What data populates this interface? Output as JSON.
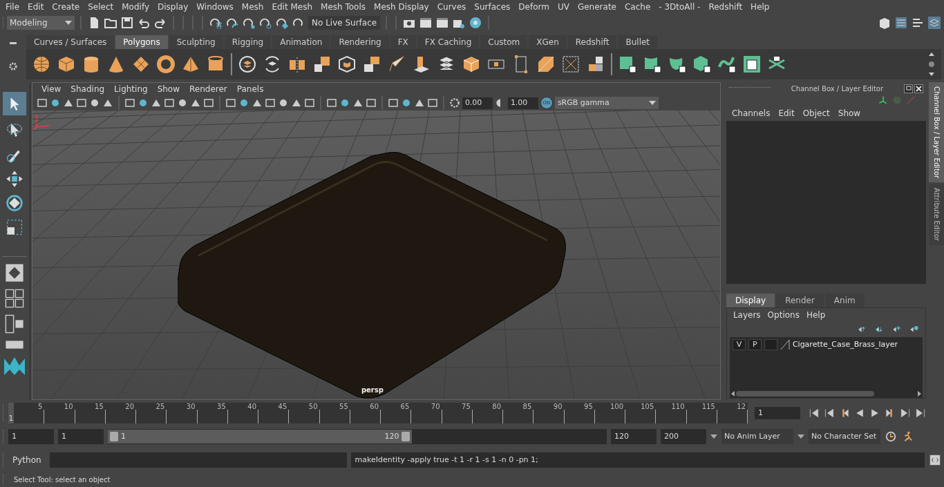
{
  "menu_bar": [
    "File",
    "Edit",
    "Create",
    "Select",
    "Modify",
    "Display",
    "Windows",
    "Mesh",
    "Edit Mesh",
    "Mesh Tools",
    "Mesh Display",
    "Curves",
    "Surfaces",
    "Deform",
    "UV",
    "Generate",
    "Cache",
    "- 3DtoAll -",
    "Redshift",
    "Help"
  ],
  "status_line": {
    "menu_set": "Modeling",
    "live_surface": "No Live Surface"
  },
  "shelf_tabs": [
    {
      "label": "Curves / Surfaces",
      "selected": false
    },
    {
      "label": "Polygons",
      "selected": true
    },
    {
      "label": "Sculpting",
      "selected": false
    },
    {
      "label": "Rigging",
      "selected": false
    },
    {
      "label": "Animation",
      "selected": false
    },
    {
      "label": "Rendering",
      "selected": false
    },
    {
      "label": "FX",
      "selected": false
    },
    {
      "label": "FX Caching",
      "selected": false
    },
    {
      "label": "Custom",
      "selected": false
    },
    {
      "label": "XGen",
      "selected": false
    },
    {
      "label": "Redshift",
      "selected": false
    },
    {
      "label": "Bullet",
      "selected": false
    }
  ],
  "viewport": {
    "menu": [
      "View",
      "Shading",
      "Lighting",
      "Show",
      "Renderer",
      "Panels"
    ],
    "exposure": "0.00",
    "gamma": "1.00",
    "color_management": {
      "badge": "ON",
      "view_transform": "sRGB gamma"
    },
    "camera": "persp"
  },
  "channel_box": {
    "title": "Channel Box / Layer Editor",
    "menu": [
      "Channels",
      "Edit",
      "Object",
      "Show"
    ],
    "side_tabs": [
      {
        "label": "Channel Box / Layer Editor",
        "selected": true
      },
      {
        "label": "Attribute Editor",
        "selected": false
      }
    ],
    "layer_tabs": [
      {
        "label": "Display",
        "selected": true
      },
      {
        "label": "Render",
        "selected": false
      },
      {
        "label": "Anim",
        "selected": false
      }
    ],
    "layer_menu": [
      "Layers",
      "Options",
      "Help"
    ],
    "layers": [
      {
        "visibility": "V",
        "playback": "P",
        "name": "Cigarette_Case_Brass_layer"
      }
    ]
  },
  "time_slider": {
    "start_marker": "1",
    "ticks": [
      "5",
      "10",
      "15",
      "20",
      "25",
      "30",
      "35",
      "40",
      "45",
      "50",
      "55",
      "60",
      "65",
      "70",
      "75",
      "80",
      "85",
      "90",
      "95",
      "100",
      "105",
      "110",
      "115",
      "12"
    ],
    "current_frame": "1",
    "level": 0
  },
  "range_slider": {
    "start": "1",
    "playback_start": "1",
    "range_start": "1",
    "range_end": "120",
    "level": 0.61,
    "playback_end": "120",
    "end": "200",
    "anim_layer": "No Anim Layer",
    "character_set": "No Character Set"
  },
  "command_line": {
    "language": "Python",
    "result": "makeIdentity -apply true -t 1 -r 1 -s 1 -n 0 -pn 1;"
  },
  "help_line": "Select Tool: select an object"
}
